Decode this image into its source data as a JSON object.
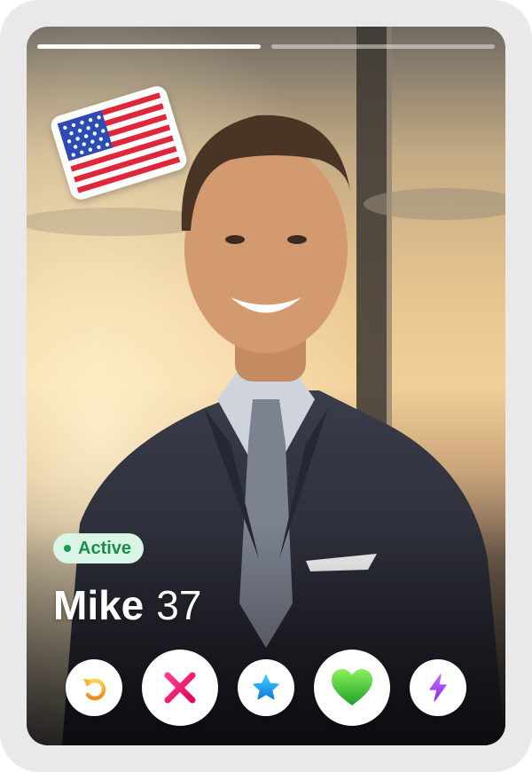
{
  "profile": {
    "name": "Mike",
    "age": "37",
    "status": "Active"
  },
  "photo_progress": {
    "total": 2,
    "current": 1
  },
  "sticker": {
    "icon": "us-flag-icon"
  },
  "actions": [
    {
      "name": "rewind",
      "icon": "rewind-icon",
      "color": "#f5a623"
    },
    {
      "name": "nope",
      "icon": "x-icon",
      "color": "#ff2a7a"
    },
    {
      "name": "super-like",
      "icon": "star-icon",
      "color": "#1ea5f5"
    },
    {
      "name": "like",
      "icon": "heart-icon",
      "color": "#38c83f"
    },
    {
      "name": "boost",
      "icon": "lightning-icon",
      "color": "#a53df2"
    }
  ],
  "colors": {
    "active_badge_bg": "#d9f5e6",
    "active_badge_text": "#1a8d4d",
    "frame": "#e9e9ea"
  }
}
